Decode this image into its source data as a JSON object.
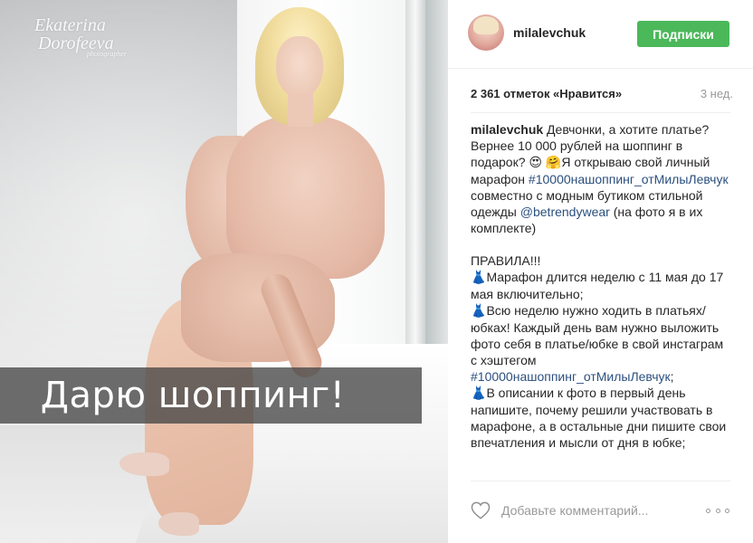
{
  "photo": {
    "watermark_line1": "Ekaterina",
    "watermark_line2": "Dorofeeva",
    "watermark_sub": "photographer",
    "banner_text": "Дарю шоппинг!"
  },
  "header": {
    "username": "milalevchuk",
    "follow_label": "Подписки",
    "follow_color": "#4bb85a"
  },
  "stats": {
    "likes": "2 361 отметок «Нравится»",
    "age": "3 нед."
  },
  "caption": {
    "author": "milalevchuk",
    "p1_a": " Девчонки, а хотите платье? Вернее 10 000 рублей на шоппинг в подарок? ",
    "emoji_heart_eyes": "😍",
    "emoji_hug": "🤗",
    "p1_b": "Я открываю свой личный марафон ",
    "hashtag1": "#10000нашоппинг_отМилыЛевчук",
    "p1_c": " совместно с модным бутиком стильной одежды ",
    "mention": "@betrendywear",
    "p1_d": " (на фото я в их комплекте)",
    "rules_title": "ПРАВИЛА!!!",
    "dress_emoji": "👗",
    "rule1": "Марафон длится неделю с 11 мая до 17 мая включительно;",
    "rule2_a": "Всю неделю нужно ходить в платьях/юбках! Каждый день вам нужно выложить фото себя в платье/юбке в свой инстаграм с хэштегом ",
    "hashtag2": "#10000нашоппинг_отМилыЛевчук",
    "rule2_b": ";",
    "rule3": "В описании к фото в первый день напишите, почему решили участвовать в марафоне, а в остальные дни пишите свои впечатления и мысли от дня в юбке;"
  },
  "footer": {
    "comment_placeholder": "Добавьте комментарий..."
  },
  "icons": {
    "like": "heart-icon",
    "more": "more-icon"
  }
}
